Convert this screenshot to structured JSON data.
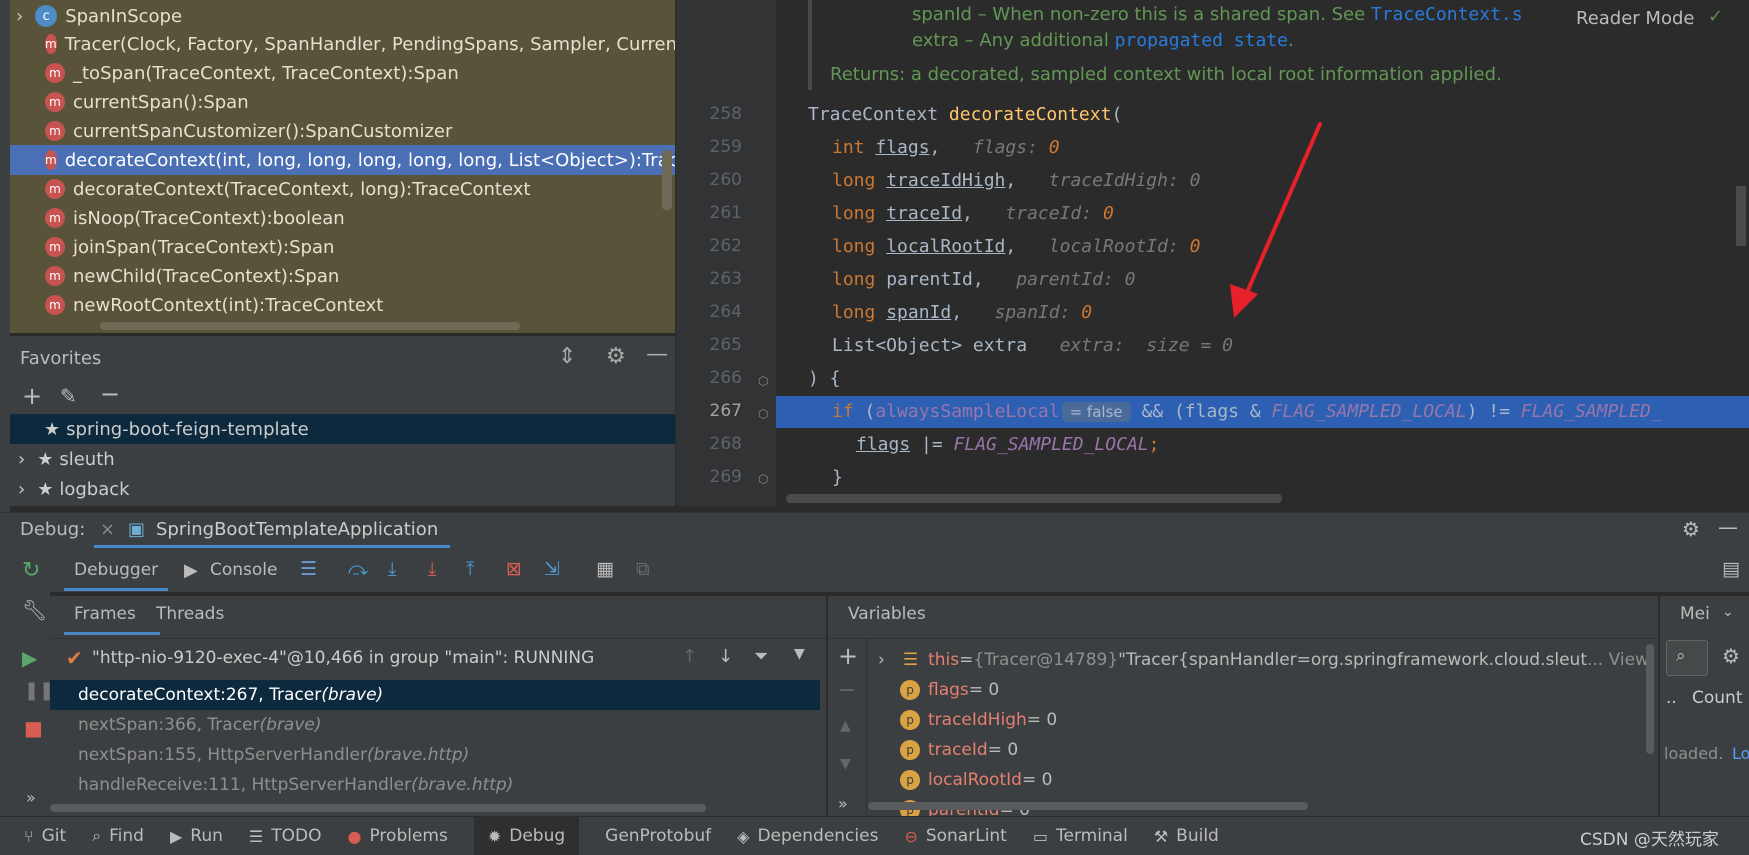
{
  "structure": {
    "class_item": "SpanInScope",
    "methods": [
      "Tracer(Clock, Factory, SpanHandler, PendingSpans, Sampler, CurrentTr",
      "_toSpan(TraceContext, TraceContext):Span",
      "currentSpan():Span",
      "currentSpanCustomizer():SpanCustomizer",
      "decorateContext(int, long, long, long, long, long, List<Object>):TraceC",
      "decorateContext(TraceContext, long):TraceContext",
      "isNoop(TraceContext):boolean",
      "joinSpan(TraceContext):Span",
      "newChild(TraceContext):Span",
      "newRootContext(int):TraceContext"
    ]
  },
  "favorites": {
    "title": "Favorites",
    "items": [
      "spring-boot-feign-template",
      "sleuth",
      "logback"
    ]
  },
  "editor": {
    "reader_mode": "Reader Mode",
    "doc": {
      "spanid_name": "spanId",
      "spanid_desc": " – When non-zero this is a shared span. See ",
      "spanid_link": "TraceContext.s",
      "extra_name": "extra",
      "extra_desc": " – Any additional ",
      "extra_link": "propagated state",
      "extra_end": ".",
      "returns_label": "Returns:",
      "returns_desc": " a decorated, sampled context with local root information applied."
    },
    "line_numbers": [
      "258",
      "259",
      "260",
      "261",
      "262",
      "263",
      "264",
      "265",
      "266",
      "267",
      "268",
      "269"
    ],
    "lines": {
      "l258_type": "TraceContext ",
      "l258_fn": "decorateContext",
      "l258_paren": "(",
      "p1_type": "int ",
      "p1_name": "flags",
      "p1_hint": "flags: ",
      "p1_val": "0",
      "p2_type": "long ",
      "p2_name": "traceIdHigh",
      "p2_hint": "traceIdHigh: ",
      "p2_val": "0",
      "p3_type": "long ",
      "p3_name": "traceId",
      "p3_hint": "traceId: ",
      "p3_val": "0",
      "p4_type": "long ",
      "p4_name": "localRootId",
      "p4_hint": "localRootId: ",
      "p4_val": "0",
      "p5_type": "long ",
      "p5_name": "parentId",
      "p5_hint": "parentId: ",
      "p5_val": "0",
      "p6_type": "long ",
      "p6_name": "spanId",
      "p6_hint": "spanId: ",
      "p6_val": "0",
      "p7_type": "List<Object> extra",
      "p7_hint": "extra:  size = 0",
      "l266": ") {",
      "l267_if": "if ",
      "l267_open": "(",
      "l267_var": "alwaysSampleLocal",
      "l267_inline": "= false",
      "l267_rest": " && (flags & ",
      "l267_const": "FLAG_SAMPLED_LOCAL",
      "l267_rest2": ") != ",
      "l267_const2": "FLAG_SAMPLED_",
      "l268_var": "flags",
      "l268_op": " |= ",
      "l268_const": "FLAG_SAMPLED_LOCAL",
      "l268_end": ";",
      "l269": "}"
    }
  },
  "debug": {
    "label": "Debug:",
    "session": "SpringBootTemplateApplication",
    "tab_debugger": "Debugger",
    "tab_console": "Console",
    "tab_frames": "Frames",
    "tab_threads": "Threads",
    "thread": "\"http-nio-9120-exec-4\"@10,466 in group \"main\": RUNNING",
    "frames": [
      {
        "method": "decorateContext:267, Tracer ",
        "pkg": "(brave)"
      },
      {
        "method": "nextSpan:366, Tracer ",
        "pkg": "(brave)"
      },
      {
        "method": "nextSpan:155, HttpServerHandler ",
        "pkg": "(brave.http)"
      },
      {
        "method": "handleReceive:111, HttpServerHandler ",
        "pkg": "(brave.http)"
      }
    ],
    "variables_title": "Variables",
    "variables": {
      "this_name": "this",
      "this_eq": " = ",
      "this_ref": "{Tracer@14789} ",
      "this_val": "\"Tracer{spanHandler=org.springframework.cloud.sleut",
      "this_more": "... View",
      "items": [
        {
          "name": "flags",
          "value": " = 0"
        },
        {
          "name": "traceIdHigh",
          "value": " = 0"
        },
        {
          "name": "traceId",
          "value": " = 0"
        },
        {
          "name": "localRootId",
          "value": " = 0"
        },
        {
          "name": "parentId",
          "value": " = 0"
        }
      ]
    },
    "memory_tab": "Mei",
    "memory_col": "Count",
    "memory_loaded": "loaded.",
    "memory_link": "Lo"
  },
  "statusbar": {
    "items": [
      "Git",
      "Find",
      "Run",
      "TODO",
      "Problems",
      "Debug",
      "GenProtobuf",
      "Dependencies",
      "SonarLint",
      "Terminal",
      "Build"
    ],
    "watermark": "CSDN @天然玩家"
  },
  "colors": {
    "arrow": "#e8202a",
    "selection": "#4a6fb5",
    "current_line": "#2d5fb3"
  }
}
